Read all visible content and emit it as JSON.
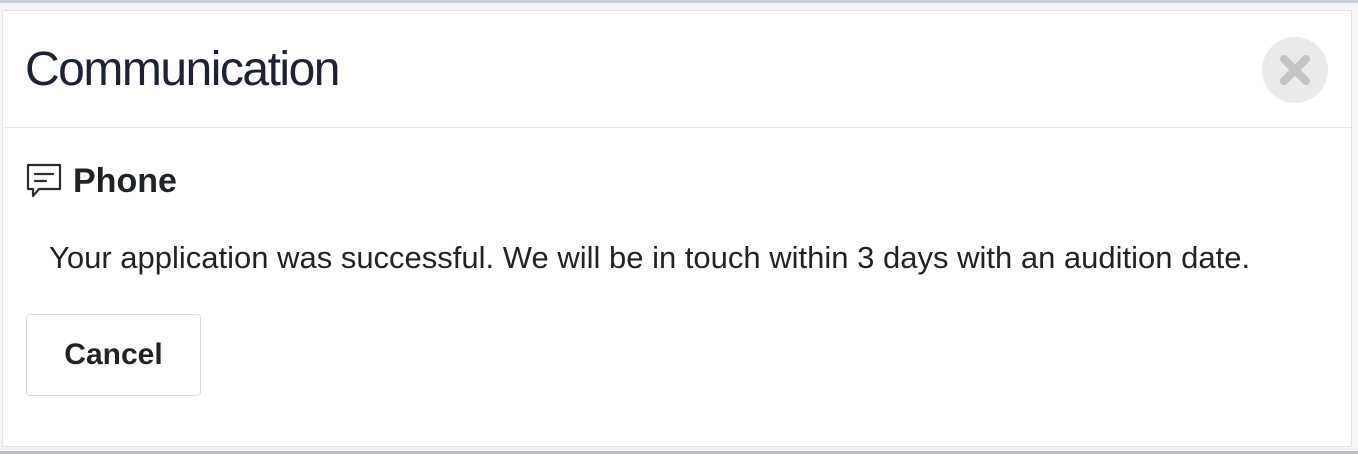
{
  "modal": {
    "title": "Communication",
    "close_icon": "close-x-icon",
    "section": {
      "icon": "message-bubble-icon",
      "label": "Phone"
    },
    "message": "Your application was successful. We will be in touch within 3 days with an audition date.",
    "cancel_label": "Cancel"
  },
  "colors": {
    "title_text": "#1c2233",
    "body_text": "#1f2326",
    "close_button_bg": "#eaeaea",
    "close_icon": "#c4c4c4",
    "border": "#dde2e7"
  }
}
